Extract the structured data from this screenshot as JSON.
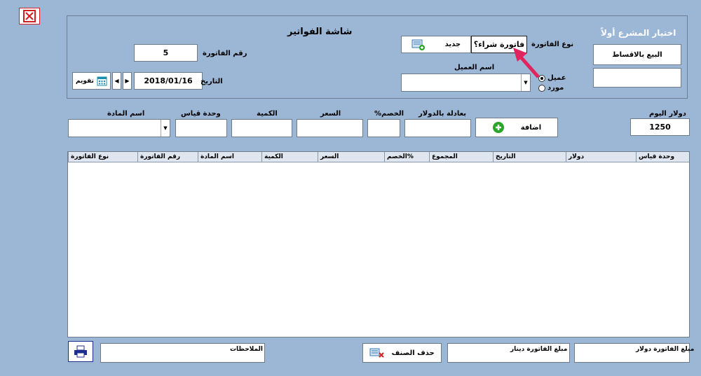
{
  "form": {
    "title": "شاشة الفواتير",
    "project_prompt": "اختيار المشرع أولاً",
    "installment_button": "البيع بالاقساط",
    "invoice_number_label": "رقم الفاتورة",
    "invoice_number_value": "5",
    "date_label": "التاريخ",
    "date_value": "2018/01/16",
    "calendar_button": "تقويم",
    "invoice_type_label": "نوع الفاتورة",
    "invoice_type_value": "فاتورة شراء؟",
    "new_button": "جديد",
    "client_name_label": "اسم العميل",
    "radio_client": "عميل",
    "radio_supplier": "مورد",
    "dollar_today_label": "دولار اليوم",
    "dollar_today_value": "1250",
    "add_button": "اضافة",
    "equiv_dollar_label": "بعادلة بالدولار",
    "discount_label": "الخصم%",
    "price_label": "السعر",
    "quantity_label": "الكمية",
    "unit_label": "وحدة قياس",
    "item_name_label": "اسم المادة",
    "delete_row_button": "حذف الصنف",
    "notes_label": "الملاحظات",
    "amount_dinar_label": "مبلغ الفاتورة دينار",
    "amount_dollar_label": "مبلغ الفاتورة دولار"
  },
  "grid": {
    "columns": [
      "نوع الفاتورة",
      "رقم الفاتورة",
      "اسم المادة",
      "الكمية",
      "السعر",
      "الخصم%",
      "المجموع",
      "التاريخ",
      "دولار",
      "وحدة قياس"
    ]
  },
  "colors": {
    "background": "#9cb6d6",
    "accent_red": "#e0245e",
    "close_red": "#d21f1f",
    "add_green": "#2aa52a"
  }
}
